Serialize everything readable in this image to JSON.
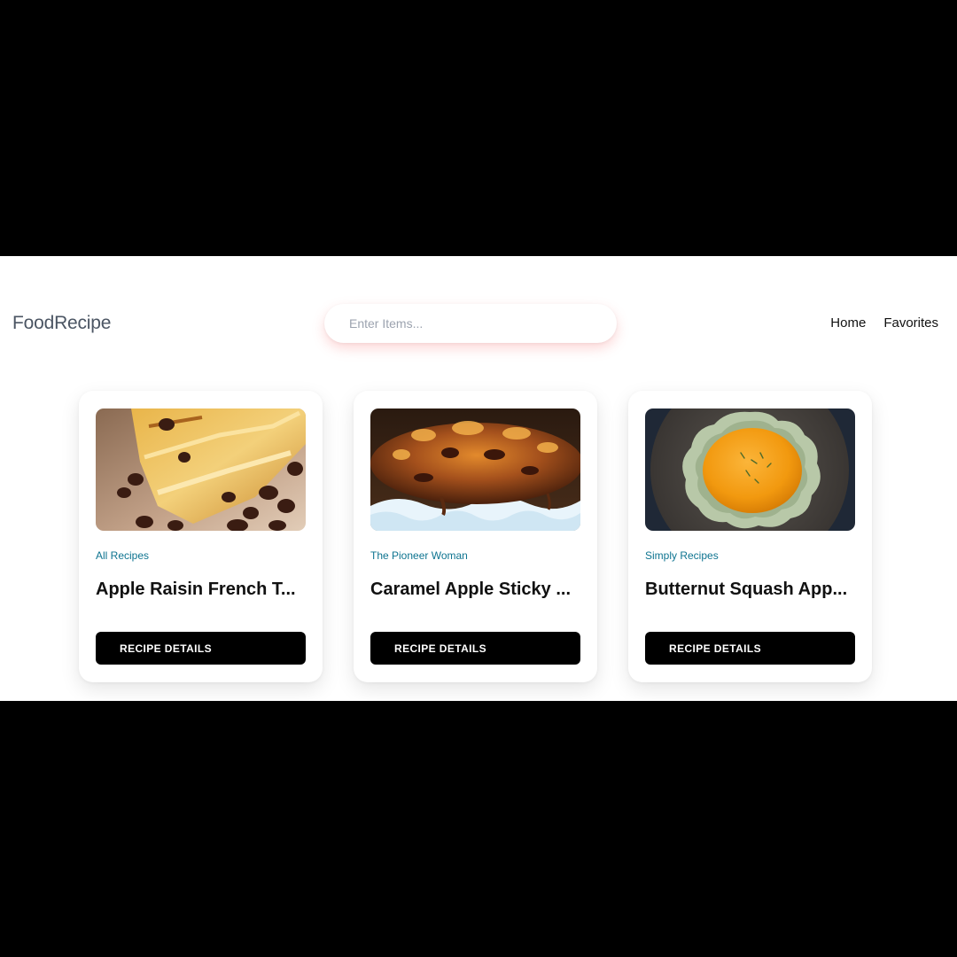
{
  "navbar": {
    "brand": "FoodRecipe",
    "search": {
      "placeholder": "Enter Items...",
      "value": ""
    },
    "links": [
      {
        "label": "Home"
      },
      {
        "label": "Favorites"
      }
    ]
  },
  "recipes": [
    {
      "publisher": "All Recipes",
      "title": "Apple Raisin French T...",
      "button_label": "RECIPE DETAILS",
      "image_icon": "food-photo-bread-pudding"
    },
    {
      "publisher": "The Pioneer Woman",
      "title": "Caramel Apple Sticky ...",
      "button_label": "RECIPE DETAILS",
      "image_icon": "food-photo-sticky-bun"
    },
    {
      "publisher": "Simply Recipes",
      "title": "Butternut Squash App...",
      "button_label": "RECIPE DETAILS",
      "image_icon": "food-photo-soup-bowl"
    }
  ],
  "colors": {
    "letterbox": "#000000",
    "page_bg": "#ffffff",
    "brand_text": "#4b5563",
    "publisher_text": "#0e7490",
    "button_bg": "#000000",
    "button_text": "#ffffff",
    "search_glow": "#f87171"
  }
}
